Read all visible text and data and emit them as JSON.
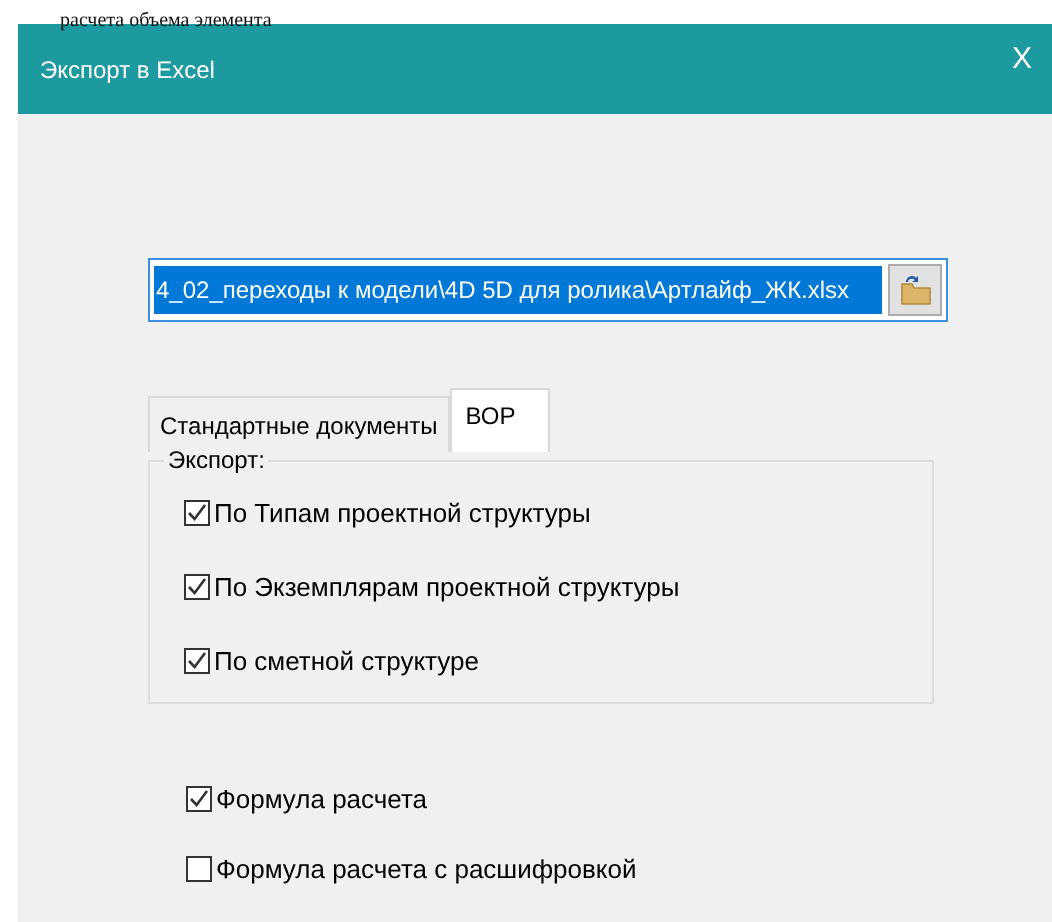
{
  "background_text": "расчета объема элемента",
  "window": {
    "title": "Экспорт в Excel",
    "close": "X"
  },
  "file_path": {
    "value": "4_02_переходы к модели\\4D 5D для ролика\\Артлайф_ЖК.xlsx"
  },
  "tabs": [
    {
      "label": "Стандартные документы",
      "selected": false
    },
    {
      "label": "ВОР",
      "selected": true
    }
  ],
  "export_group": {
    "legend": "Экспорт:",
    "options": [
      {
        "label": "По Типам проектной структуры",
        "checked": true
      },
      {
        "label": "По Экземплярам проектной структуры",
        "checked": true
      },
      {
        "label": "По сметной структуре",
        "checked": true
      }
    ]
  },
  "options": [
    {
      "label": "Формула расчета",
      "checked": true
    },
    {
      "label": "Формула расчета с расшифровкой",
      "checked": false
    }
  ]
}
